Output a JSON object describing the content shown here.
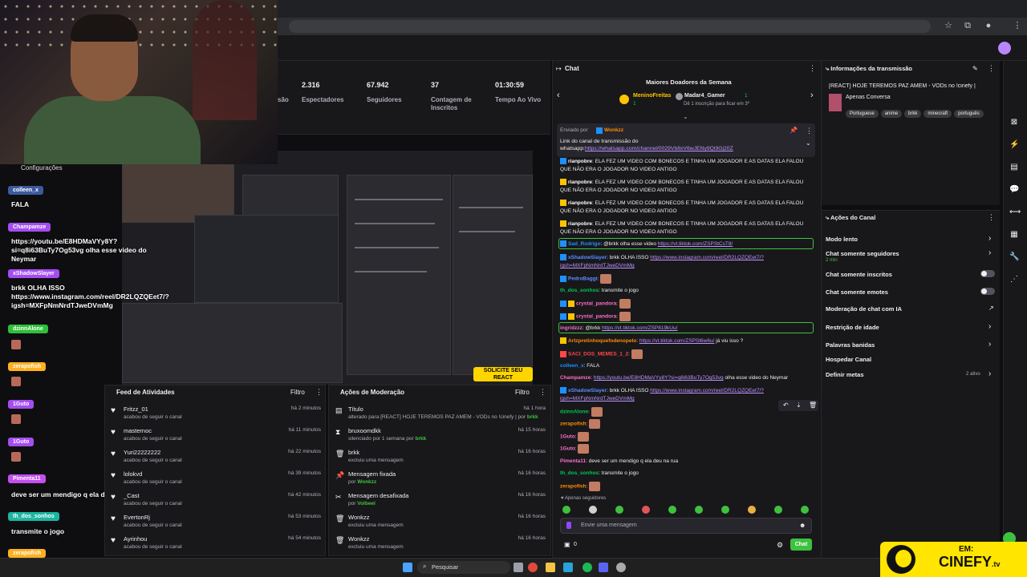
{
  "stats": [
    {
      "value": "2.316",
      "label": "Espectadores"
    },
    {
      "value": "67.942",
      "label": "Seguidores"
    },
    {
      "value": "37",
      "label": "Contagem de Inscritos"
    },
    {
      "value": "01:30:59",
      "label": "Tempo Ao Vivo"
    }
  ],
  "stats_cut_label": "são",
  "overlay": {
    "config": "Configurações",
    "items": [
      {
        "name": "colleen_x",
        "msg": "FALA"
      },
      {
        "name": "Champamze",
        "msg": "https://youtu.be/E8HDMaVYy8Y?si=q8i63BuTy7Og53vg olha esse video do Neymar"
      },
      {
        "name": "xShadowSlayer",
        "msg": "brkk OLHA ISSO https://www.instagram.com/reel/DR2LQZQEet7/?igsh=MXFpNmNrdTJweDVmMg"
      },
      {
        "name": "dzinnAlone"
      },
      {
        "name": "zerapofish"
      },
      {
        "name": "1Guto"
      },
      {
        "name": "1Guto"
      },
      {
        "name": "Pimenta11",
        "msg": "deve ser um mendigo q ela deu na rua"
      },
      {
        "name": "th_dos_sonhos",
        "msg": "transmite o jogo"
      },
      {
        "name": "zerapofish"
      }
    ]
  },
  "preview": {
    "badge": "SOLICITE SEU REACT"
  },
  "feed": {
    "title": "Feed de Atividades",
    "filter": "Filtro",
    "rows": [
      {
        "name": "Fritzz_01",
        "sub": "acabou de seguir o canal",
        "time": "há 2 minutos"
      },
      {
        "name": "masternoc",
        "sub": "acabou de seguir o canal",
        "time": "há 11 minutos"
      },
      {
        "name": "Yuri22222222",
        "sub": "acabou de seguir o canal",
        "time": "há 22 minutos"
      },
      {
        "name": "lolokvd",
        "sub": "acabou de seguir o canal",
        "time": "há 39 minutos"
      },
      {
        "name": "_Cast",
        "sub": "acabou de seguir o canal",
        "time": "há 42 minutos"
      },
      {
        "name": "EvertonRj",
        "sub": "acabou de seguir o canal",
        "time": "há 53 minutos"
      },
      {
        "name": "Ayrinhou",
        "sub": "acabou de seguir o canal",
        "time": "há 54 minutos"
      }
    ]
  },
  "mod": {
    "title": "Ações de Moderação",
    "filter": "Filtro",
    "rows": [
      {
        "name": "Título",
        "sub": "alterado para [REACT] HOJE TEREMOS PAZ AMÉM - VODs no !cinefy | por",
        "by": "brkk",
        "time": "há 1 hora",
        "icon": "▤"
      },
      {
        "name": "bruxoomdkk",
        "sub": "silenciado por 1 semana por",
        "by": "brkk",
        "time": "há 15 horas",
        "icon": "⧗"
      },
      {
        "name": "brkk",
        "sub": "excluiu uma mensagem",
        "by": "",
        "time": "há 16 horas",
        "icon": "🗑"
      },
      {
        "name": "Mensagem fixada",
        "sub": "por",
        "by": "Wonkzz",
        "time": "há 16 horas",
        "icon": "📌"
      },
      {
        "name": "Mensagem desafixada",
        "sub": "por",
        "by": "Volbeel",
        "time": "há 16 horas",
        "icon": "✂"
      },
      {
        "name": "Wonkzz",
        "sub": "excluiu uma mensagem",
        "by": "",
        "time": "há 16 horas",
        "icon": "🗑"
      },
      {
        "name": "Wonkzz",
        "sub": "excluiu uma mensagem",
        "by": "",
        "time": "há 16 horas",
        "icon": "🗑"
      }
    ]
  },
  "chat": {
    "title": "Chat",
    "donors_title": "Maiores Doadores da Semana",
    "donor1": "MeninoFreitas",
    "donor1_count": "1",
    "donor2": "Madar4_Gamer",
    "donor2_count": "1",
    "donor2_sub": "Dê 1 inscrição para ficar em 3º",
    "pinned_by_label": "Enviado por",
    "pinned_by": "Wonkzz",
    "pinned_text": "Link do canal de transmissão do whatsapp:",
    "pinned_link": "https://whatsapp.com/channel/0029Vb8xV6wJENy9Qi9Gj20Z",
    "msg_dup": "ELA FEZ UM VIDEO COM BONECOS E TINHA UM JOGADOR E AS DATAS ELA FALOU QUE NÃO ERA O JOGADOR NO VIDEO ANTIGO",
    "msg_dup_user": "rianpobre",
    "sad_user": "Sad_Rodrigo",
    "sad_msg": "@brkk olha esse video",
    "sad_link": "https://vt.tiktok.com/ZSPStCsT8/",
    "xs_user": "xShadowSlayer",
    "xs_msg": "brkk OLHA ISSO",
    "xs_link": "https://www.instagram.com/reel/DR2LQZQEet7/?igsh=MXFpNmNrdTJweDVmMg",
    "pedro": "PedroBaggi",
    "thdos": "th_dos_sonhos",
    "thdos_msg": "transmite o jogo",
    "crystal": "crystal_pandora",
    "ingrid": "ingridzzz",
    "ingrid_msg": "@brkk",
    "ingrid_link": "https://vt.tiktok.com/ZSP819kUu/",
    "artz": "Artzpretinhoquefodenopelo",
    "artz_link": "https://vt.tiktok.com/ZSPSt6w6u/",
    "artz_msg": "já viu isso ?",
    "saci": "SACI_DOS_MEMES_1_2",
    "colleen": "colleen_x",
    "colleen_msg": "FALA",
    "champ": "Champamze",
    "champ_link": "https://youtu.be/E8HDMaVYy8Y?si=q8i63BuTy7Og53vg",
    "champ_msg": "olha esse video do Neymar",
    "dzinn": "dzinnAlone",
    "zera": "zerapofish",
    "guto": "1Guto",
    "pimenta": "Pimenta11",
    "pimenta_msg": "deve ser um mendigo q ela deu na rua",
    "followers_only": "Apenas seguidores",
    "placeholder": "Envie uma mensagem",
    "points": "0",
    "send": "Chat"
  },
  "info": {
    "title": "Informações da transmissão",
    "stream_title": "[REACT] HOJE TEREMOS PAZ AMÉM - VODs no !cinefy |",
    "category": "Apenas Conversa",
    "tags": [
      "Portuguese",
      "anime",
      "brkk",
      "minecraft",
      "português"
    ]
  },
  "actions": {
    "title": "Ações do Canal",
    "items": [
      {
        "label": "Modo lento",
        "kind": "chevron"
      },
      {
        "label": "Chat somente seguidores",
        "sub": "2 min",
        "kind": "chevron"
      },
      {
        "label": "Chat somente inscritos",
        "kind": "toggle"
      },
      {
        "label": "Chat somente emotes",
        "kind": "toggle"
      },
      {
        "label": "Moderação de chat com IA",
        "kind": "external"
      },
      {
        "label": "Restrição de idade",
        "kind": "chevron"
      },
      {
        "label": "Palavras banidas",
        "kind": "chevron"
      },
      {
        "label": "Hospedar Canal",
        "kind": "none"
      },
      {
        "label": "Definir metas",
        "sub_right": "2 ativo",
        "kind": "chevron"
      }
    ]
  },
  "taskbar": {
    "search": "Pesquisar"
  },
  "brand": {
    "em": "EM:",
    "name": "CINEFY",
    "suffix": ".tv"
  },
  "colors": {
    "accent": "#9147ff",
    "highlight": "#3ec13e",
    "brand_yellow": "#ffe500"
  }
}
